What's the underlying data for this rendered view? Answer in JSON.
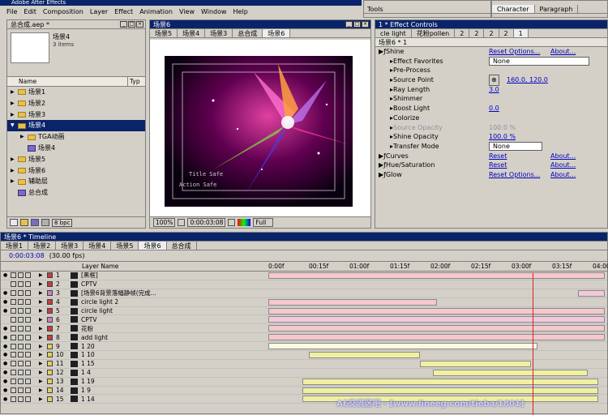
{
  "app": {
    "title": "Adobe After Effects"
  },
  "menu": [
    "File",
    "Edit",
    "Composition",
    "Layer",
    "Effect",
    "Animation",
    "View",
    "Window",
    "Help"
  ],
  "project": {
    "title": "总合成.aep *",
    "selected_name": "场景4",
    "selected_info": "3 items",
    "col_name": "Name",
    "col_type": "Typ",
    "bpc": "8 bpc",
    "items": [
      {
        "label": "场景1",
        "kind": "folder",
        "indent": 0,
        "open": false,
        "sel": false
      },
      {
        "label": "场景2",
        "kind": "folder",
        "indent": 0,
        "open": false,
        "sel": false
      },
      {
        "label": "场景3",
        "kind": "folder",
        "indent": 0,
        "open": false,
        "sel": false
      },
      {
        "label": "场景4",
        "kind": "folder",
        "indent": 0,
        "open": true,
        "sel": true
      },
      {
        "label": "TGA动画",
        "kind": "folder",
        "indent": 1,
        "open": false,
        "sel": false
      },
      {
        "label": "场景4",
        "kind": "comp",
        "indent": 1,
        "open": false,
        "sel": false
      },
      {
        "label": "场景5",
        "kind": "folder",
        "indent": 0,
        "open": false,
        "sel": false
      },
      {
        "label": "场景6",
        "kind": "folder",
        "indent": 0,
        "open": false,
        "sel": false
      },
      {
        "label": "辅助层",
        "kind": "folder",
        "indent": 0,
        "open": false,
        "sel": false
      },
      {
        "label": "总合成",
        "kind": "comp",
        "indent": 0,
        "open": false,
        "sel": false
      }
    ]
  },
  "viewer": {
    "title": "场景6",
    "tabs": [
      "场景5",
      "场景4",
      "场景3",
      "总合成",
      "场景6"
    ],
    "title_safe": "Title Safe",
    "action_safe": "Action Safe",
    "zoom": "100%",
    "time": "0:00:03:08",
    "res": "Full"
  },
  "tools": {
    "title": "Tools"
  },
  "character": {
    "tabs": [
      "Character",
      "Paragraph"
    ]
  },
  "effects": {
    "title": "1 * Effect Controls",
    "tabs": [
      "cle light",
      "花粉pollen",
      "2",
      "2",
      "2",
      "2",
      "1"
    ],
    "header": "场景6 * 1",
    "rows": [
      {
        "indent": 0,
        "name": "Shine",
        "reset": "Reset Options...",
        "about": "About...",
        "fx": true
      },
      {
        "indent": 1,
        "name": "Effect Favorites",
        "value": "None",
        "dropdown": true
      },
      {
        "indent": 1,
        "name": "Pre-Process"
      },
      {
        "indent": 1,
        "name": "Source Point",
        "value": "160.0, 120.0",
        "crosshair": true
      },
      {
        "indent": 1,
        "name": "Ray Length",
        "value": "3.0"
      },
      {
        "indent": 1,
        "name": "Shimmer"
      },
      {
        "indent": 1,
        "name": "Boost Light",
        "value": "0.0"
      },
      {
        "indent": 1,
        "name": "Colorize"
      },
      {
        "indent": 1,
        "name": "Source Opacity",
        "value": "100.0 %",
        "dim": true
      },
      {
        "indent": 1,
        "name": "Shine Opacity",
        "value": "100.0 %"
      },
      {
        "indent": 1,
        "name": "Transfer Mode",
        "value": "None",
        "dropdown": true
      },
      {
        "indent": 0,
        "name": "Curves",
        "reset": "Reset",
        "about": "About...",
        "fx": true
      },
      {
        "indent": 0,
        "name": "Hue/Saturation",
        "reset": "Reset",
        "about": "About...",
        "fx": true
      },
      {
        "indent": 0,
        "name": "Glow",
        "reset": "Reset Options...",
        "about": "About...",
        "fx": true
      }
    ]
  },
  "timeline": {
    "title": "场景6 * Timeline",
    "tabs": [
      "场景1",
      "场景2",
      "场景3",
      "场景4",
      "场景5",
      "场景6",
      "总合成"
    ],
    "time": "0:00:03:08",
    "fps": "(30.00 fps)",
    "col_layer": "Layer Name",
    "ruler": [
      "0:00f",
      "00:15f",
      "01:00f",
      "01:15f",
      "02:00f",
      "02:15f",
      "03:00f",
      "03:15f",
      "04:00f"
    ],
    "layers": [
      {
        "n": "1",
        "name": "[黑框]",
        "color": "#c04040",
        "vis": true,
        "bar_start": 0,
        "bar_end": 1,
        "bar": "#f4c8cc"
      },
      {
        "n": "2",
        "name": "CPTV",
        "color": "#c04040",
        "vis": false,
        "bar_start": 0,
        "bar_end": 0,
        "bar": "#f4c8cc"
      },
      {
        "n": "3",
        "name": "[场景6背景落幅静帧(完成...",
        "color": "#d080c0",
        "vis": true,
        "bar_start": 0.92,
        "bar_end": 1,
        "bar": "#f4c8dc"
      },
      {
        "n": "4",
        "name": "circle light 2",
        "color": "#c04040",
        "vis": true,
        "bar_start": 0,
        "bar_end": 0.5,
        "bar": "#f4c8cc"
      },
      {
        "n": "5",
        "name": "circle light",
        "color": "#c04040",
        "vis": true,
        "bar_start": 0,
        "bar_end": 1,
        "bar": "#f4c8cc"
      },
      {
        "n": "6",
        "name": "CPTV",
        "color": "#d080c0",
        "vis": false,
        "bar_start": 0,
        "bar_end": 1,
        "bar": "#f4c8dc"
      },
      {
        "n": "7",
        "name": "花粉",
        "color": "#c04040",
        "vis": true,
        "bar_start": 0,
        "bar_end": 1,
        "bar": "#f4c8cc"
      },
      {
        "n": "8",
        "name": "add light",
        "color": "#c04040",
        "vis": true,
        "bar_start": 0,
        "bar_end": 1,
        "bar": "#f4c8cc"
      },
      {
        "n": "9",
        "name": "1 20",
        "color": "#e0d060",
        "vis": true,
        "bar_start": 0,
        "bar_end": 0.8,
        "bar": "#fafae0"
      },
      {
        "n": "10",
        "name": "1 10",
        "color": "#e0d060",
        "vis": true,
        "bar_start": 0.12,
        "bar_end": 0.45,
        "bar": "#f0f0a0"
      },
      {
        "n": "11",
        "name": "1 15",
        "color": "#e0d060",
        "vis": true,
        "bar_start": 0.45,
        "bar_end": 0.78,
        "bar": "#f0f0a0"
      },
      {
        "n": "12",
        "name": "1 4",
        "color": "#e0d060",
        "vis": true,
        "bar_start": 0.49,
        "bar_end": 0.95,
        "bar": "#f0f0a0"
      },
      {
        "n": "13",
        "name": "1 19",
        "color": "#e0d060",
        "vis": true,
        "bar_start": 0.1,
        "bar_end": 0.98,
        "bar": "#f0f0a0"
      },
      {
        "n": "14",
        "name": "1 9",
        "color": "#e0d060",
        "vis": true,
        "bar_start": 0.1,
        "bar_end": 0.98,
        "bar": "#f0f0a0"
      },
      {
        "n": "15",
        "name": "1 14",
        "color": "#e0d060",
        "vis": true,
        "bar_start": 0.1,
        "bar_end": 0.98,
        "bar": "#f0f0a0"
      }
    ],
    "playhead": 0.785
  },
  "watermark": "AE交流区吧 - [www.lineeg.com/tieba/1801]"
}
